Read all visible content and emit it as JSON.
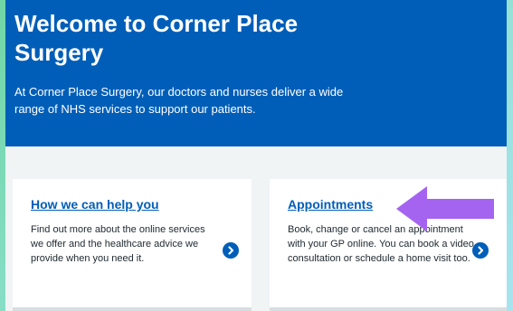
{
  "hero": {
    "title": "Welcome to Corner Place Surgery",
    "description": "At Corner Place Surgery, our doctors and nurses deliver a wide range of NHS services to support our patients."
  },
  "cards": [
    {
      "title": "How we can help you",
      "description": "Find out more about the online services we offer and the healthcare advice we provide when you need it.",
      "icon": "chevron-right-circle-icon"
    },
    {
      "title": "Appointments",
      "description": "Book, change or cancel an appointment with your GP online. You can book a video consultation or schedule a home visit too.",
      "icon": "chevron-right-circle-icon"
    }
  ],
  "annotation": {
    "icon": "left-arrow-icon",
    "color": "#a564f0"
  },
  "colors": {
    "brand_blue": "#005eb8",
    "page_bg": "#f0f4f5"
  }
}
